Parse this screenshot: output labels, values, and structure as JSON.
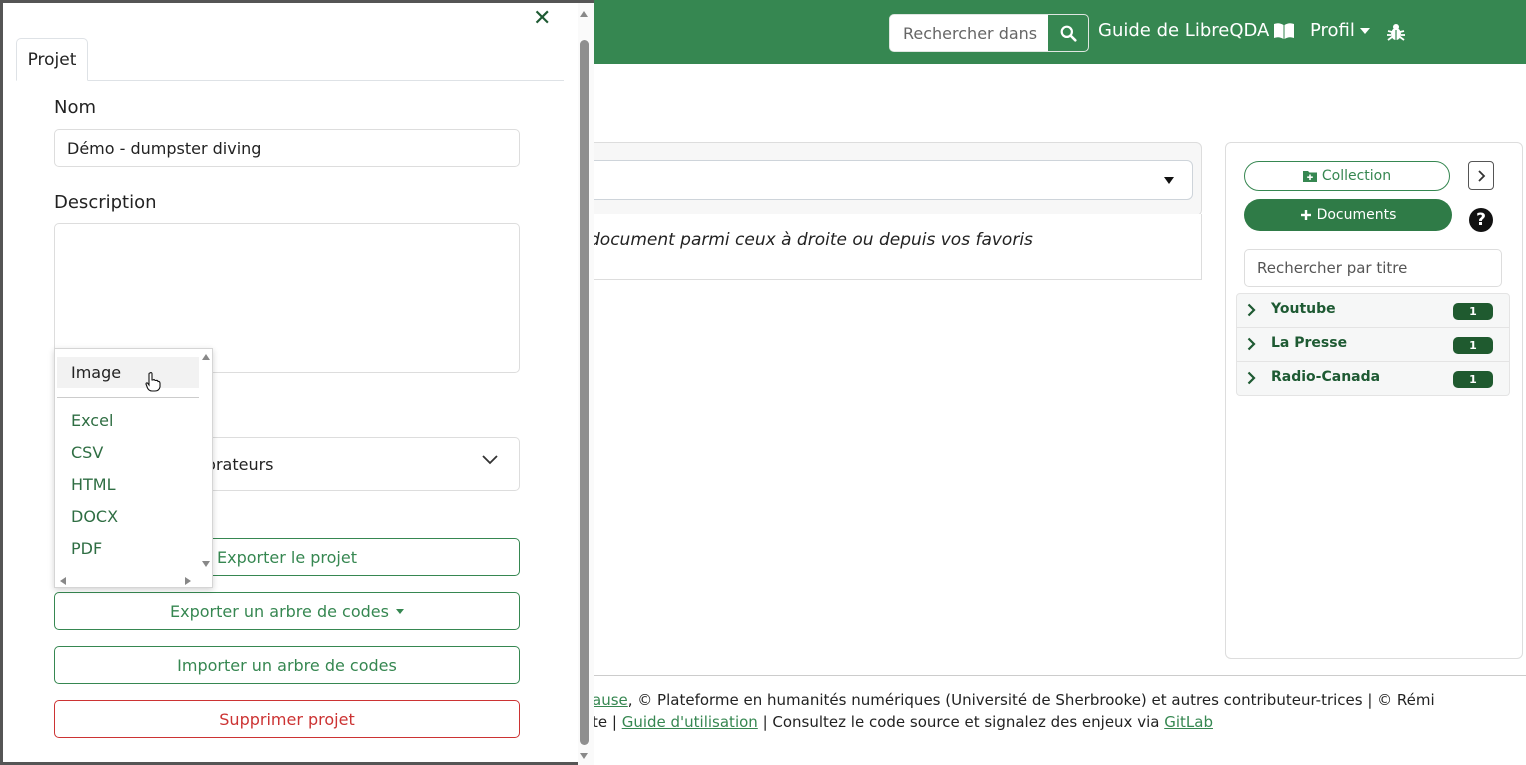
{
  "colors": {
    "brand": "#368751",
    "danger": "#cc3333",
    "badge": "#1f5a2f"
  },
  "navbar": {
    "search_placeholder": "Rechercher dans",
    "guide_label": "Guide de LibreQDA",
    "profile_label": "Profil",
    "icons": [
      "search-icon",
      "book-icon",
      "bug-icon"
    ]
  },
  "main": {
    "hint": "document parmi ceux à droite ou depuis vos favoris"
  },
  "right_panel": {
    "collection_button": "Collection",
    "documents_button": "Documents",
    "title_search_placeholder": "Rechercher par titre",
    "collections": [
      {
        "name": "Youtube",
        "count": "1"
      },
      {
        "name": "La Presse",
        "count": "1"
      },
      {
        "name": "Radio-Canada",
        "count": "1"
      }
    ]
  },
  "footer": {
    "line1_link": "ause",
    "line1_text": ", © Plateforme en humanités numériques (Université de Sherbrooke) et autres contributeur-trices | © Rémi",
    "line2_prefix": "te | ",
    "line2_link1": "Guide d'utilisation",
    "line2_middle": " | Consultez le code source et signalez des enjeux via ",
    "line2_link2": "GitLab"
  },
  "project_panel": {
    "tab_label": "Projet",
    "name_label": "Nom",
    "name_value": "Démo - dumpster diving",
    "description_label": "Description",
    "description_value": "",
    "collaborators_partial": "porateurs",
    "export_project": "Exporter le projet",
    "export_code_tree": "Exporter un arbre de codes",
    "import_code_tree": "Importer un arbre de codes",
    "delete_project": "Supprimer projet"
  },
  "export_dropdown": {
    "items": [
      "Image",
      "Excel",
      "CSV",
      "HTML",
      "DOCX",
      "PDF"
    ],
    "hovered": "Image"
  }
}
